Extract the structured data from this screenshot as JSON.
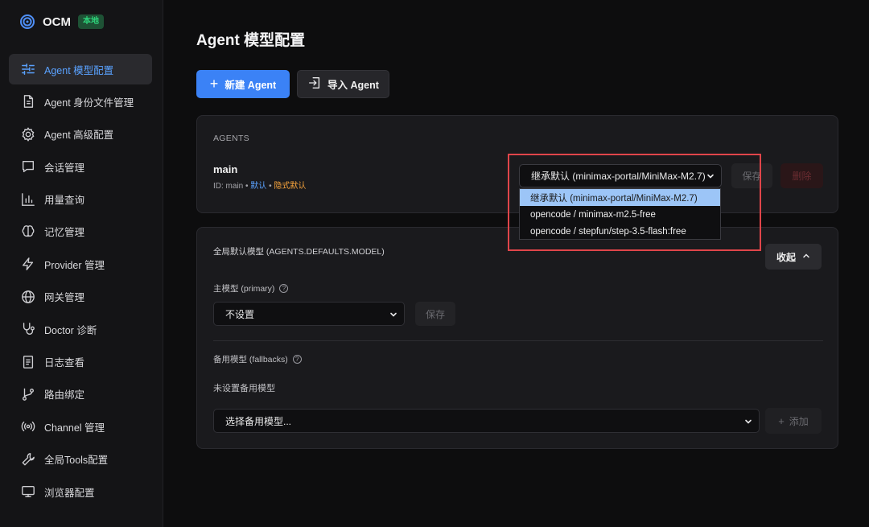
{
  "brand": {
    "name": "OCM",
    "badge": "本地"
  },
  "sidebar": {
    "items": [
      {
        "label": "Agent 模型配置",
        "icon": "sliders-icon",
        "active": true
      },
      {
        "label": "Agent 身份文件管理",
        "icon": "file-text-icon"
      },
      {
        "label": "Agent 高级配置",
        "icon": "gear-icon"
      },
      {
        "label": "会话管理",
        "icon": "chat-icon"
      },
      {
        "label": "用量查询",
        "icon": "bar-chart-icon"
      },
      {
        "label": "记忆管理",
        "icon": "brain-icon"
      },
      {
        "label": "Provider 管理",
        "icon": "zap-icon"
      },
      {
        "label": "网关管理",
        "icon": "globe-icon"
      },
      {
        "label": "Doctor 诊断",
        "icon": "stethoscope-icon"
      },
      {
        "label": "日志查看",
        "icon": "log-icon"
      },
      {
        "label": "路由绑定",
        "icon": "git-branch-icon"
      },
      {
        "label": "Channel 管理",
        "icon": "radio-icon"
      },
      {
        "label": "全局Tools配置",
        "icon": "wrench-icon"
      },
      {
        "label": "浏览器配置",
        "icon": "monitor-icon"
      }
    ]
  },
  "main": {
    "title": "Agent 模型配置",
    "new_agent": "新建 Agent",
    "import_agent": "导入 Agent"
  },
  "agents_card": {
    "section": "AGENTS",
    "agent_name": "main",
    "meta_id": "ID: main",
    "meta_sep": " • ",
    "meta_default": "默认",
    "meta_implicit": "隐式默认",
    "selected_model": "继承默认 (minimax-portal/MiniMax-M2.7)",
    "save": "保存",
    "delete": "删除",
    "dropdown_options": [
      "继承默认 (minimax-portal/MiniMax-M2.7)",
      "opencode / minimax-m2.5-free",
      "opencode / stepfun/step-3.5-flash:free"
    ]
  },
  "defaults_card": {
    "title": "全局默认模型 (AGENTS.DEFAULTS.MODEL)",
    "collapse": "收起",
    "primary_label": "主模型 (primary)",
    "primary_value": "不设置",
    "save": "保存",
    "fallback_label": "备用模型 (fallbacks)",
    "no_fallback": "未设置备用模型",
    "fallback_placeholder": "选择备用模型...",
    "add": "添加"
  },
  "colors": {
    "accent": "#3b82f6",
    "active_nav_text": "#5aa2ff",
    "badge_green": "#2ed37a",
    "implicit_orange": "#f6a33c",
    "highlight_red": "#e0454a"
  }
}
